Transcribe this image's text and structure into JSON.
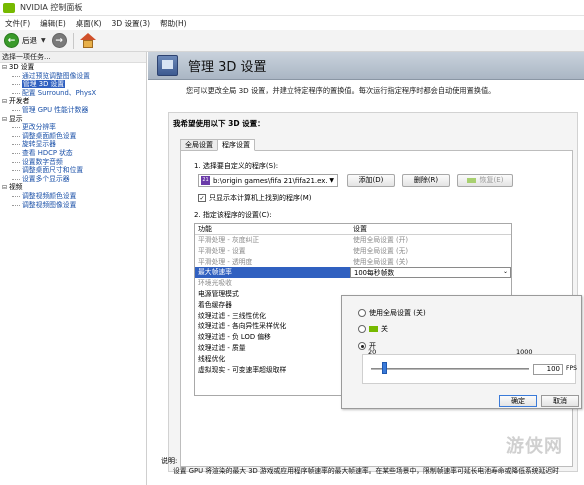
{
  "window": {
    "title": "NVIDIA 控制面板"
  },
  "menu": [
    "文件(F)",
    "编辑(E)",
    "桌面(K)",
    "3D 设置(3)",
    "帮助(H)"
  ],
  "toolbar": {
    "back_label": "后退"
  },
  "left_panel": {
    "header": "选择一项任务...",
    "tree": [
      {
        "type": "cat",
        "label": "3D 设置"
      },
      {
        "type": "leaf",
        "label": "通过预览调整图像设置"
      },
      {
        "type": "leaf",
        "label": "管理 3D 设置",
        "selected": true
      },
      {
        "type": "leaf",
        "label": "配置 Surround、PhysX"
      },
      {
        "type": "cat",
        "label": "开发者"
      },
      {
        "type": "leaf",
        "label": "管理 GPU 性能计数器"
      },
      {
        "type": "cat",
        "label": "显示"
      },
      {
        "type": "leaf",
        "label": "更改分辨率"
      },
      {
        "type": "leaf",
        "label": "调整桌面颜色设置"
      },
      {
        "type": "leaf",
        "label": "旋转显示器"
      },
      {
        "type": "leaf",
        "label": "查看 HDCP 状态"
      },
      {
        "type": "leaf",
        "label": "设置数字音频"
      },
      {
        "type": "leaf",
        "label": "调整桌面尺寸和位置"
      },
      {
        "type": "leaf",
        "label": "设置多个显示器"
      },
      {
        "type": "cat",
        "label": "视频"
      },
      {
        "type": "leaf",
        "label": "调整视频颜色设置"
      },
      {
        "type": "leaf",
        "label": "调整视频图像设置"
      }
    ]
  },
  "main": {
    "title": "管理 3D 设置",
    "subtitle": "您可以更改全局 3D 设置，并建立特定程序的置换值。每次运行指定程序时都会自动使用置换值。",
    "box_title": "我希望使用以下 3D 设置：",
    "tabs": [
      "全局设置",
      "程序设置"
    ],
    "step1_label": "1. 选择要自定义的程序(S):",
    "program_icon": "21",
    "program_value": "b:\\origin games\\fifa 21\\fifa21.ex...",
    "add_label": "添加(D)",
    "remove_label": "删除(R)",
    "restore_label": "恢复(E)",
    "checkbox_label": "只显示本计算机上找到的程序(M)",
    "step2_label": "2. 指定该程序的设置(C):",
    "grid_headers": [
      "功能",
      "设置"
    ],
    "grid_rows": [
      {
        "feature": "平滑处理 - 灰度纠正",
        "setting": "使用全局设置 (开)",
        "dim": true
      },
      {
        "feature": "平滑处理 - 设置",
        "setting": "使用全局设置 (无)",
        "dim": true
      },
      {
        "feature": "平滑处理 - 透明度",
        "setting": "使用全局设置 (关)",
        "dim": true
      },
      {
        "feature": "最大帧速率",
        "setting": "100每秒帧数",
        "selected": true
      },
      {
        "feature": "环境光吸收",
        "setting": "",
        "dim": true
      },
      {
        "feature": "电源管理模式",
        "setting": ""
      },
      {
        "feature": "着色缓存器",
        "setting": ""
      },
      {
        "feature": "纹理过滤 - 三线性优化",
        "setting": ""
      },
      {
        "feature": "纹理过滤 - 各向异性采样优化",
        "setting": ""
      },
      {
        "feature": "纹理过滤 - 负 LOD 偏移",
        "setting": ""
      },
      {
        "feature": "纹理过滤 - 质量",
        "setting": ""
      },
      {
        "feature": "线程优化",
        "setting": ""
      },
      {
        "feature": "虚拟现实 - 可变速率超级取样",
        "setting": ""
      }
    ],
    "popup": {
      "opt_global": "使用全局设置 (关)",
      "opt_off": "关",
      "opt_on": "开",
      "slider_min": "20",
      "slider_max": "1000",
      "fps_value": "100",
      "fps_unit": "FPS",
      "slider_level": 0.08,
      "ok_label": "确定",
      "cancel_label": "取消"
    },
    "desc_title": "说明:",
    "desc_text": "设置 GPU 将渲染的最大 3D 游戏或应用程序帧速率的最大帧速率。在某些场景中，限制帧速率可延长电池寿命或降低系统延迟时"
  },
  "watermark": "游侠网"
}
